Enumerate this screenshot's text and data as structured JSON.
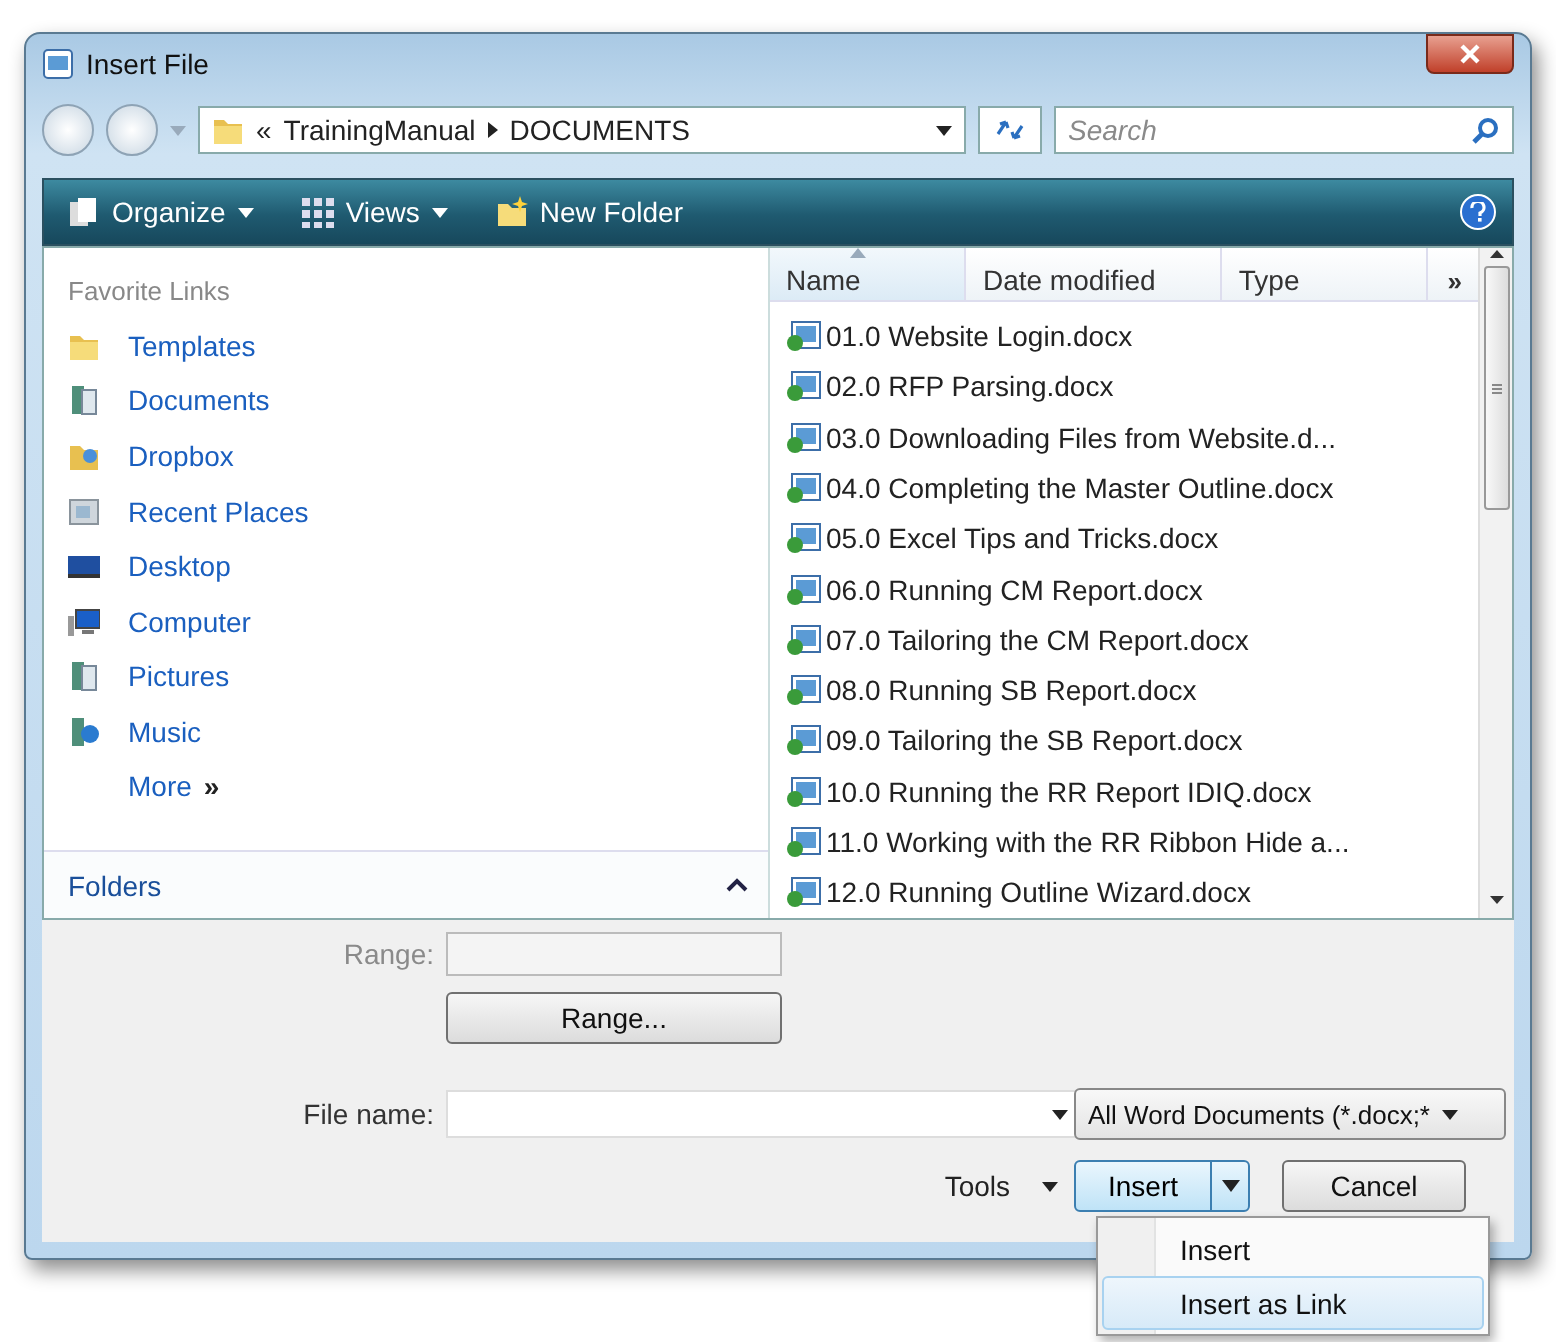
{
  "window": {
    "title": "Insert File"
  },
  "address_bar": {
    "prefix": "«",
    "path": [
      "TrainingManual",
      "DOCUMENTS"
    ]
  },
  "search": {
    "placeholder": "Search"
  },
  "toolbar": [
    {
      "label": "Organize",
      "kind": "menu"
    },
    {
      "label": "Views",
      "kind": "menu"
    },
    {
      "label": "New Folder",
      "kind": "button"
    }
  ],
  "sidebar": {
    "heading": "Favorite Links",
    "items": [
      {
        "label": "Templates",
        "kind": "folder"
      },
      {
        "label": "Documents",
        "kind": "library"
      },
      {
        "label": "Dropbox",
        "kind": "dropbox"
      },
      {
        "label": "Recent Places",
        "kind": "recent"
      },
      {
        "label": "Desktop",
        "kind": "desktop"
      },
      {
        "label": "Computer",
        "kind": "computer"
      },
      {
        "label": "Pictures",
        "kind": "library"
      },
      {
        "label": "Music",
        "kind": "music"
      }
    ],
    "more": "More",
    "more_glyph": "»",
    "folders": "Folders"
  },
  "file_list": {
    "columns": [
      {
        "label": "Name",
        "sorted": true
      },
      {
        "label": "Date modified",
        "sorted": false
      },
      {
        "label": "Type",
        "sorted": false
      }
    ],
    "overflow_glyph": "»",
    "rows": [
      "01.0 Website Login.docx",
      "02.0 RFP Parsing.docx",
      "03.0 Downloading Files from Website.d...",
      "04.0 Completing the Master Outline.docx",
      "05.0 Excel Tips and Tricks.docx",
      "06.0 Running CM Report.docx",
      "07.0 Tailoring the CM Report.docx",
      "08.0 Running SB Report.docx",
      "09.0 Tailoring the SB Report.docx",
      "10.0 Running the RR Report IDIQ.docx",
      "11.0 Working with the RR Ribbon Hide a...",
      "12.0 Running Outline Wizard.docx"
    ]
  },
  "range": {
    "label": "Range:",
    "disabled": true,
    "button": "Range..."
  },
  "file_name": {
    "label": "File name:"
  },
  "file_type": {
    "value": "All Word Documents (*.docx;*"
  },
  "tools": "Tools",
  "buttons": {
    "insert": "Insert",
    "cancel": "Cancel"
  },
  "insert_menu": [
    {
      "label": "Insert",
      "selected": false
    },
    {
      "label": "Insert as Link",
      "selected": true
    }
  ]
}
